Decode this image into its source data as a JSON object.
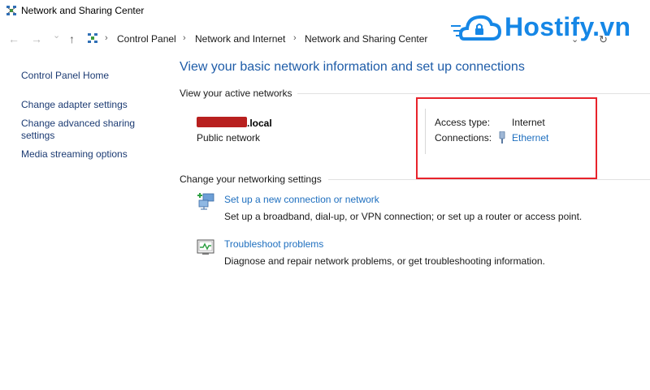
{
  "window": {
    "title": "Network and Sharing Center"
  },
  "nav": {
    "back_glyph": "←",
    "forward_glyph": "→",
    "history_glyph": "⌄",
    "up_glyph": "↑",
    "chevron_glyph": "⌄",
    "refresh_glyph": "↻",
    "sep_glyph": "›"
  },
  "breadcrumb": [
    "Control Panel",
    "Network and Internet",
    "Network and Sharing Center"
  ],
  "watermark": {
    "text": "Hostify.vn",
    "color": "#1687e6"
  },
  "sidebar": {
    "items": [
      {
        "label": "Control Panel Home"
      },
      {
        "label": "Change adapter settings"
      },
      {
        "label": "Change advanced sharing settings"
      },
      {
        "label": "Media streaming options"
      }
    ]
  },
  "main": {
    "heading": "View your basic network information and set up connections",
    "active_networks": {
      "title": "View your active networks",
      "network_name_suffix": ".local",
      "network_type": "Public network",
      "access_type_label": "Access type:",
      "access_type_value": "Internet",
      "connections_label": "Connections:",
      "connections_value": "Ethernet"
    },
    "settings": {
      "title": "Change your networking settings",
      "tasks": [
        {
          "link": "Set up a new connection or network",
          "desc": "Set up a broadband, dial-up, or VPN connection; or set up a router or access point."
        },
        {
          "link": "Troubleshoot problems",
          "desc": "Diagnose and repair network problems, or get troubleshooting information."
        }
      ]
    }
  },
  "colors": {
    "link": "#1e6fbf",
    "heading": "#1e5ca8",
    "highlight": "#e8232b",
    "redaction": "#b8201f"
  }
}
